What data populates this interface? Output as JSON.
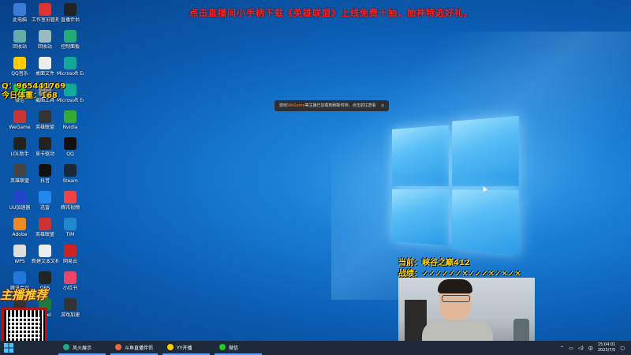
{
  "marquee": "点击直播间小手柄下载《英雄联盟》上线免费十抽，抽神特选好礼。",
  "overlay": {
    "qq": "Q：965441769",
    "physical": "今日体重：168",
    "current": "当前：峡谷之巅412",
    "record": "战绩：✓✓✓✓✓✓✕✓✓✓✕✓✕✓✕"
  },
  "toast": {
    "prefix": "游戏",
    "highlight": "WeGame",
    "text": "等主播已加载到刷新时钟，点击前往查看",
    "close": "×"
  },
  "promo": "主播推荐",
  "desktop_icons": [
    {
      "label": "此电脑",
      "icon": "computer-icon",
      "color": "#3a7bd5"
    },
    {
      "label": "工作室旧管理",
      "icon": "app-icon",
      "color": "#d33"
    },
    {
      "label": "直播伴侣",
      "icon": "app-icon",
      "color": "#222"
    },
    {
      "label": "回收站",
      "icon": "recycle-bin-icon",
      "color": "#6aa"
    },
    {
      "label": "回收站",
      "icon": "recycle-bin-icon",
      "color": "#9bb"
    },
    {
      "label": "控制面板",
      "icon": "control-panel-icon",
      "color": "#2a7"
    },
    {
      "label": "QQ音乐",
      "icon": "app-icon",
      "color": "#fc0"
    },
    {
      "label": "桌面文件",
      "icon": "file-icon",
      "color": "#eee"
    },
    {
      "label": "Microsoft Edge",
      "icon": "edge-icon",
      "color": "#1a9"
    },
    {
      "label": "微信",
      "icon": "wechat-icon",
      "color": "#2c2"
    },
    {
      "label": "截图工具",
      "icon": "app-icon",
      "color": "#888"
    },
    {
      "label": "Microsoft Edge",
      "icon": "edge-icon",
      "color": "#1a9"
    },
    {
      "label": "WeGame",
      "icon": "app-icon",
      "color": "#c33"
    },
    {
      "label": "英雄联盟",
      "icon": "app-icon",
      "color": "#333"
    },
    {
      "label": "Nvidia",
      "icon": "app-icon",
      "color": "#3a3"
    },
    {
      "label": "LOL助手",
      "icon": "app-icon",
      "color": "#222"
    },
    {
      "label": "显卡驱动",
      "icon": "app-icon",
      "color": "#222"
    },
    {
      "label": "QQ",
      "icon": "qq-icon",
      "color": "#111"
    },
    {
      "label": "英雄联盟",
      "icon": "app-icon",
      "color": "#444"
    },
    {
      "label": "抖音",
      "icon": "app-icon",
      "color": "#111"
    },
    {
      "label": "Steam",
      "icon": "steam-icon",
      "color": "#1b2838"
    },
    {
      "label": "UU加速器",
      "icon": "app-icon",
      "color": "#24c"
    },
    {
      "label": "迅雷",
      "icon": "app-icon",
      "color": "#28e"
    },
    {
      "label": "腾讯视频",
      "icon": "app-icon",
      "color": "#e44"
    },
    {
      "label": "Adobe",
      "icon": "app-icon",
      "color": "#e82"
    },
    {
      "label": "英雄联盟",
      "icon": "app-icon",
      "color": "#c33"
    },
    {
      "label": "TIM",
      "icon": "app-icon",
      "color": "#28c"
    },
    {
      "label": "WPS",
      "icon": "app-icon",
      "color": "#ddd"
    },
    {
      "label": "新建文本文档",
      "icon": "file-icon",
      "color": "#eee"
    },
    {
      "label": "网易云",
      "icon": "app-icon",
      "color": "#c22"
    },
    {
      "label": "腾讯会议",
      "icon": "app-icon",
      "color": "#27d"
    },
    {
      "label": "OBS",
      "icon": "app-icon",
      "color": "#222"
    },
    {
      "label": "小红书",
      "icon": "app-icon",
      "color": "#e46"
    },
    {
      "label": "英雄联盟",
      "icon": "app-icon",
      "color": "#333"
    },
    {
      "label": "Excel",
      "icon": "excel-icon",
      "color": "#1b7a3c"
    },
    {
      "label": "游戏加速",
      "icon": "app-icon",
      "color": "#333"
    }
  ],
  "taskbar": {
    "items": [
      {
        "label": "风火展示",
        "color": "#2a8"
      },
      {
        "label": "斗鱼直播伴侣",
        "color": "#e64"
      },
      {
        "label": "YY开播",
        "color": "#fc0"
      },
      {
        "label": "微信",
        "color": "#2c2"
      }
    ],
    "time": "15:04:01",
    "date": "2023/7/5"
  }
}
